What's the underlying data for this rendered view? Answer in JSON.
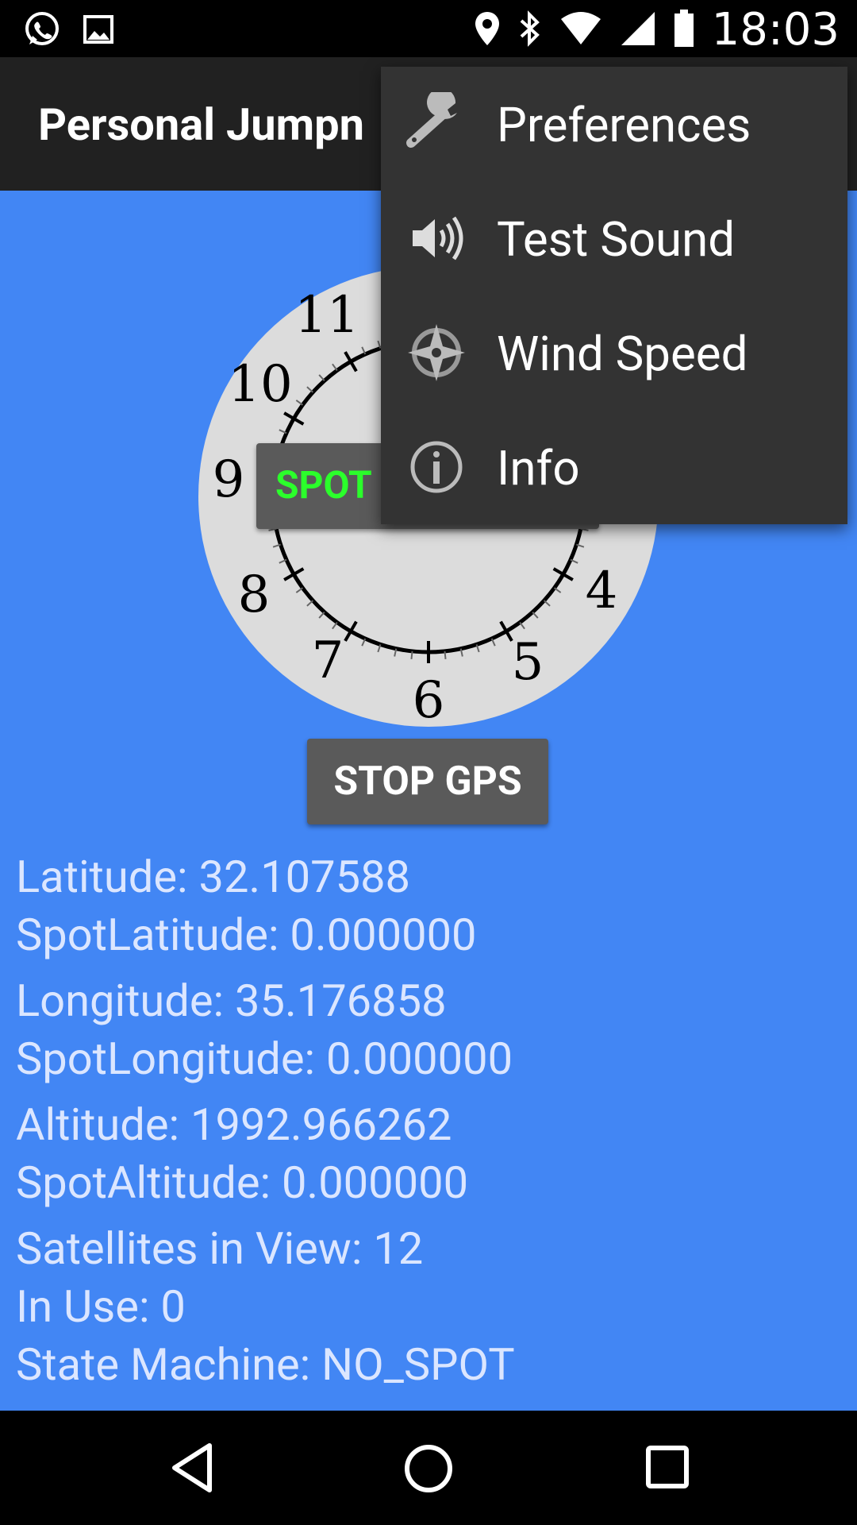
{
  "status_bar": {
    "time": "18:03",
    "left_icons": [
      "whatsapp-icon",
      "gallery-icon"
    ],
    "right_icons": [
      "location-icon",
      "bluetooth-icon",
      "wifi-icon",
      "cell-signal-icon",
      "battery-icon"
    ]
  },
  "app_bar": {
    "title": "Personal Jumpn"
  },
  "dial": {
    "hour_numbers": [
      "11",
      "10",
      "9",
      "8",
      "7",
      "6",
      "5",
      "4"
    ]
  },
  "spot_button": {
    "label": "SPOT"
  },
  "stop_gps_button": {
    "label": "STOP GPS"
  },
  "gps_info": {
    "latitude": "Latitude: 32.107588",
    "spot_latitude": "SpotLatitude: 0.000000",
    "longitude": "Longitude: 35.176858",
    "spot_longitude": "SpotLongitude: 0.000000",
    "altitude": "Altitude: 1992.966262",
    "spot_altitude": "SpotAltitude: 0.000000",
    "satellites": "Satellites in View: 12",
    "in_use": "In Use: 0",
    "state_machine": "State Machine: NO_SPOT"
  },
  "overflow_menu": {
    "items": [
      {
        "label": "Preferences",
        "icon": "wrench-icon"
      },
      {
        "label": "Test Sound",
        "icon": "speaker-icon"
      },
      {
        "label": "Wind Speed",
        "icon": "compass-icon"
      },
      {
        "label": "Info",
        "icon": "info-icon"
      }
    ]
  },
  "nav_bar": {
    "buttons": [
      "back-icon",
      "home-icon",
      "recents-icon"
    ]
  },
  "colors": {
    "background": "#4286f4",
    "app_bar": "#212121",
    "menu": "#333333",
    "button": "#5a5a5a",
    "spot_text": "#2bff2b",
    "info_text": "#dbe6ff"
  }
}
